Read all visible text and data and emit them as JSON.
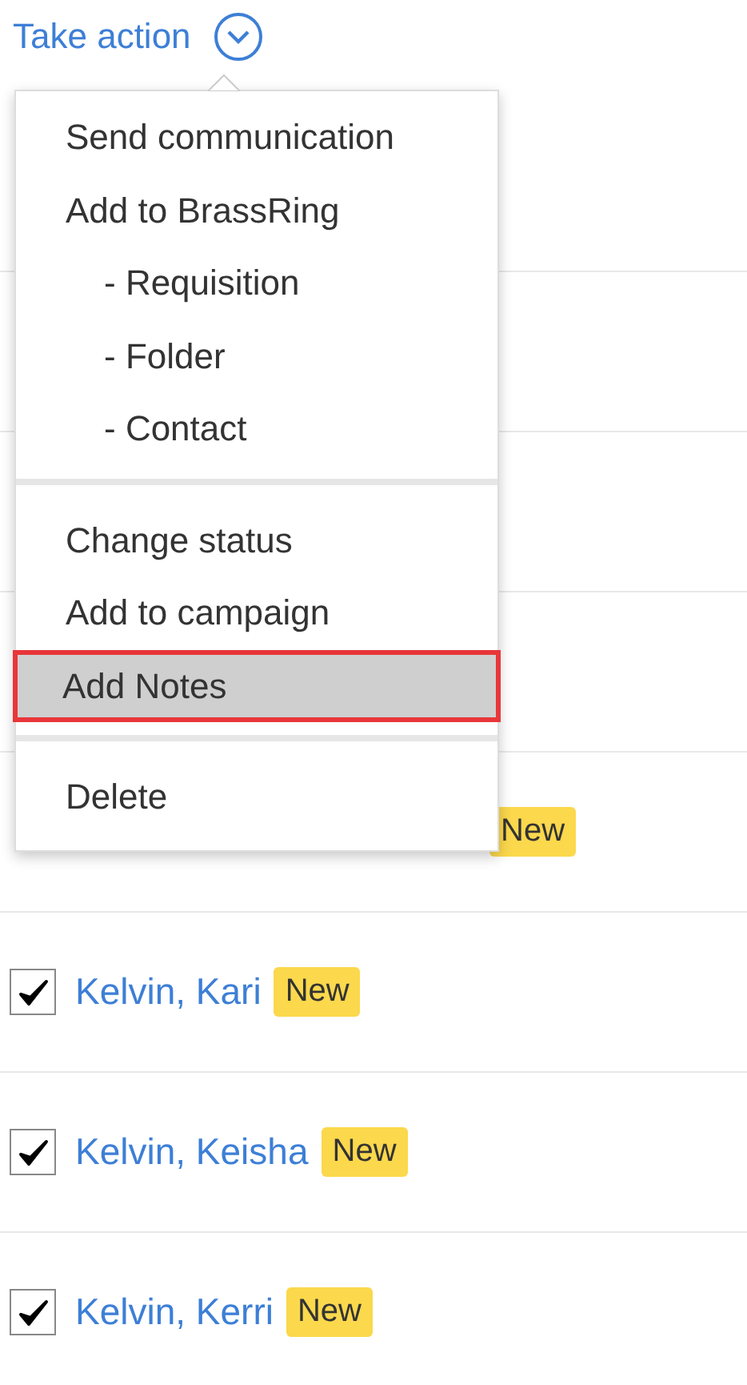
{
  "header": {
    "title": "Take action",
    "expanded": true
  },
  "menu": {
    "groups": [
      {
        "items": [
          {
            "label": "Send communication",
            "indent": false,
            "highlighted": false
          },
          {
            "label": "Add to BrassRing",
            "indent": false,
            "highlighted": false
          },
          {
            "label": "- Requisition",
            "indent": true,
            "highlighted": false
          },
          {
            "label": "- Folder",
            "indent": true,
            "highlighted": false
          },
          {
            "label": "- Contact",
            "indent": true,
            "highlighted": false
          }
        ]
      },
      {
        "items": [
          {
            "label": "Change status",
            "indent": false,
            "highlighted": false
          },
          {
            "label": "Add to campaign",
            "indent": false,
            "highlighted": false
          },
          {
            "label": "Add Notes",
            "indent": false,
            "highlighted": true
          }
        ]
      },
      {
        "items": [
          {
            "label": "Delete",
            "indent": false,
            "highlighted": false
          }
        ]
      }
    ]
  },
  "rows": [
    {
      "kind": "covered"
    },
    {
      "kind": "covered"
    },
    {
      "kind": "covered"
    },
    {
      "kind": "covered"
    },
    {
      "kind": "covered",
      "badge": "New"
    },
    {
      "kind": "candidate",
      "name": "Kelvin, Kari",
      "badge": "New",
      "checked": true
    },
    {
      "kind": "candidate",
      "name": "Kelvin, Keisha",
      "badge": "New",
      "checked": true
    },
    {
      "kind": "candidate",
      "name": "Kelvin, Kerri",
      "badge": "New",
      "checked": true
    }
  ]
}
